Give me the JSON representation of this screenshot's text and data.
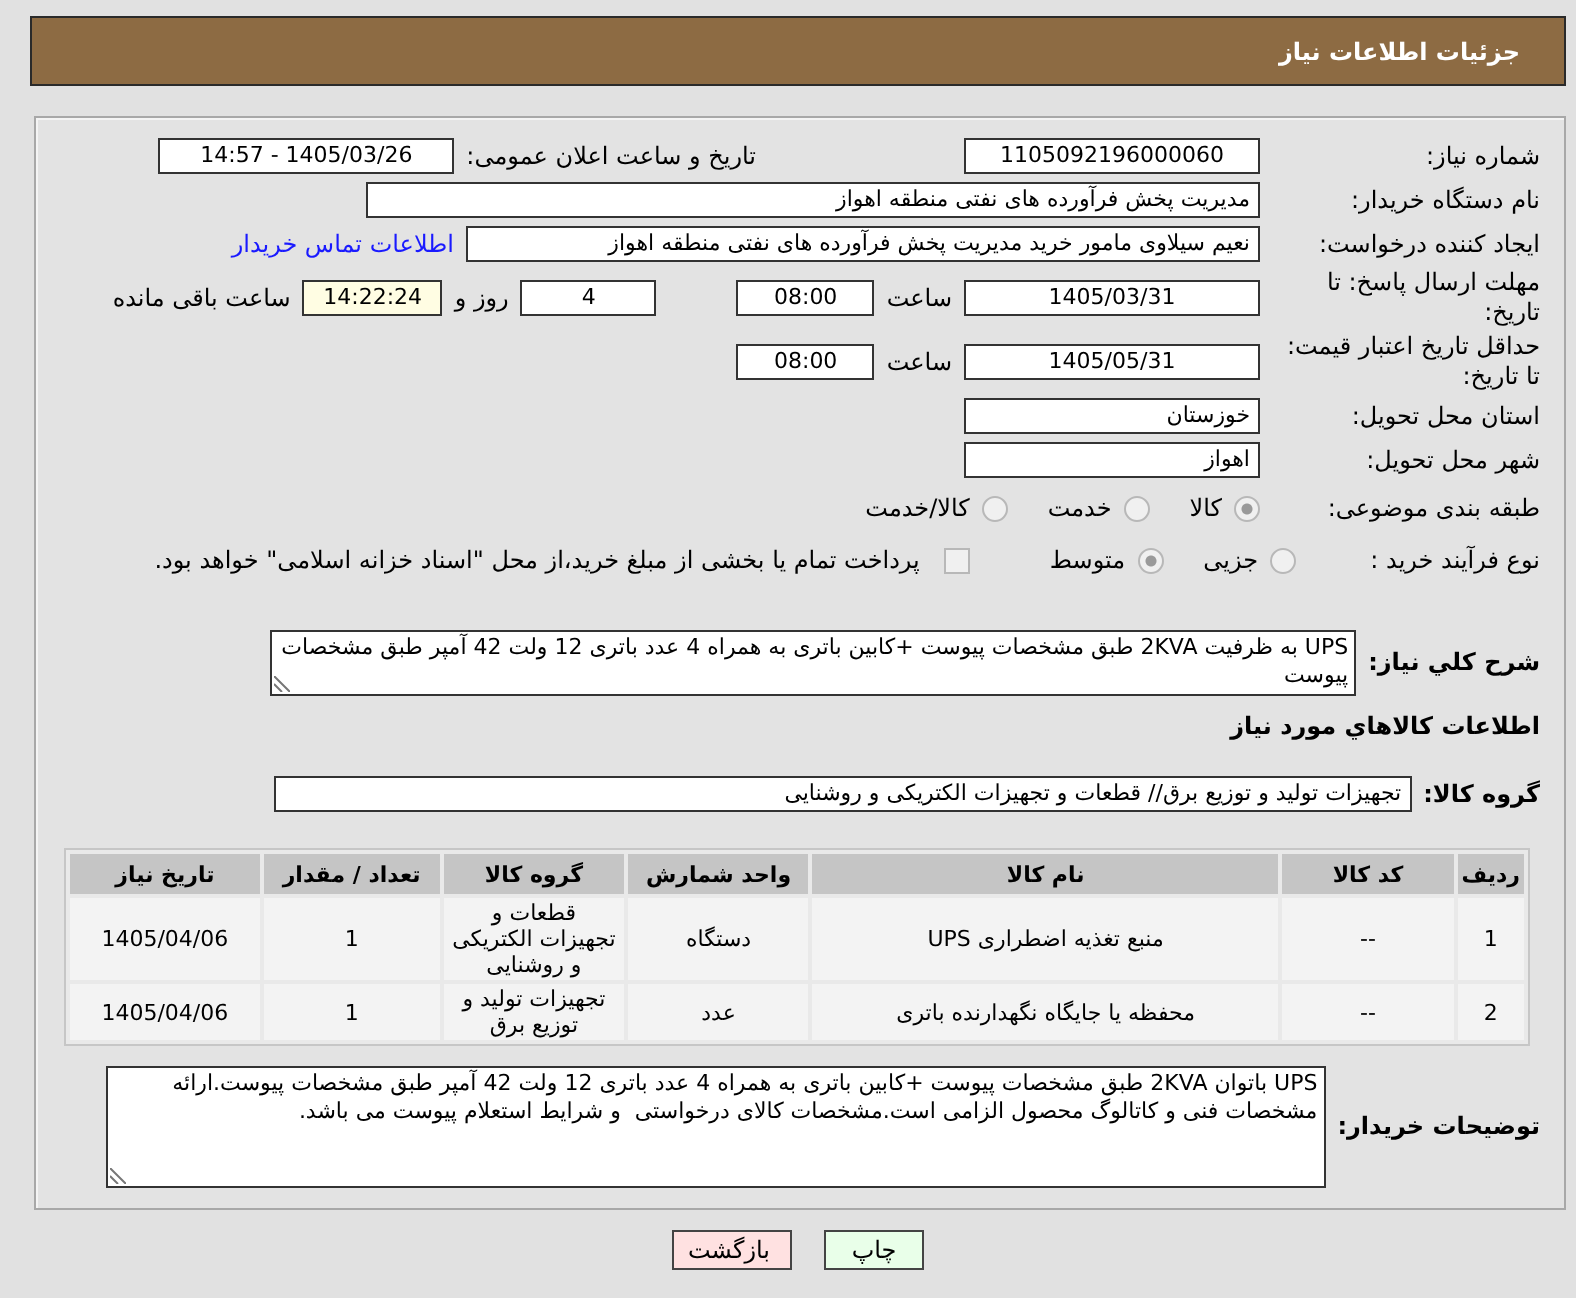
{
  "header": {
    "title": "جزئیات اطلاعات نیاز"
  },
  "need_info": {
    "need_number": {
      "label": "شماره نیاز:",
      "value": "1105092196000060"
    },
    "announce_datetime": {
      "label": "تاریخ و ساعت اعلان عمومی:",
      "value": "1405/03/26 - 14:57"
    },
    "buyer_org": {
      "label": "نام دستگاه خریدار:",
      "value": "مدیریت پخش فرآورده های نفتی منطقه اهواز"
    },
    "requester": {
      "label": "ایجاد کننده درخواست:",
      "value": "نعیم سیلاوی مامور خرید مدیریت پخش فرآورده های نفتی منطقه اهواز",
      "link": "اطلاعات تماس خریدار"
    },
    "response_deadline": {
      "label": "مهلت ارسال پاسخ: تا تاریخ:",
      "date": "1405/03/31",
      "time_label": "ساعت",
      "time": "08:00",
      "days": "4",
      "days_label": "روز و",
      "remaining": "14:22:24",
      "remaining_label": "ساعت باقی مانده"
    },
    "price_validity": {
      "label": "حداقل تاریخ اعتبار قیمت: تا تاریخ:",
      "date": "1405/05/31",
      "time_label": "ساعت",
      "time": "08:00"
    },
    "delivery_province": {
      "label": "استان محل تحویل:",
      "value": "خوزستان"
    },
    "delivery_city": {
      "label": "شهر محل تحویل:",
      "value": "اهواز"
    },
    "subject_category": {
      "label": "طبقه بندی موضوعی:",
      "options": [
        {
          "label": "کالا",
          "selected": true,
          "disabled": true
        },
        {
          "label": "خدمت",
          "selected": false,
          "disabled": true
        },
        {
          "label": "کالا/خدمت",
          "selected": false,
          "disabled": true
        }
      ]
    },
    "purchase_process": {
      "label": "نوع فرآیند خرید :",
      "options": [
        {
          "label": "جزیی",
          "selected": false,
          "disabled": true
        },
        {
          "label": "متوسط",
          "selected": true,
          "disabled": true
        }
      ],
      "treasury_payment": {
        "label": "پرداخت تمام یا بخشی از مبلغ خرید،از محل \"اسناد خزانه اسلامی\" خواهد بود.",
        "checked": false,
        "disabled": true
      }
    }
  },
  "description": {
    "label": "شرح کلي نیاز:",
    "value": "UPS به ظرفیت 2KVA طبق مشخصات پیوست +کابین باتری به همراه 4 عدد باتری 12 ولت 42 آمپر طبق مشخصات پیوست"
  },
  "items_section": {
    "title": "اطلاعات کالاهاي مورد نیاز",
    "group_label": "گروه کالا:",
    "group_value": "تجهیزات تولید و توزیع برق// قطعات و تجهیزات الکتریکی و روشنایی",
    "table": {
      "columns": [
        "ردیف",
        "کد کالا",
        "نام کالا",
        "واحد شمارش",
        "گروه کالا",
        "تعداد / مقدار",
        "تاریخ نیاز"
      ],
      "rows": [
        {
          "cells": [
            "1",
            "--",
            "منبع تغذیه اضطراری UPS",
            "دستگاه",
            "قطعات و تجهیزات الکتریکی و روشنایی",
            "1",
            "1405/04/06"
          ]
        },
        {
          "cells": [
            "2",
            "--",
            "محفظه یا جایگاه نگهدارنده باتری",
            "عدد",
            "تجهیزات تولید و توزیع برق",
            "1",
            "1405/04/06"
          ]
        }
      ]
    }
  },
  "buyer_notes": {
    "label": "توضیحات خریدار:",
    "value": "UPS باتوان 2KVA طبق مشخصات پیوست +کابین باتری به همراه 4 عدد باتری 12 ولت 42 آمپر طبق مشخصات پیوست.ارائه مشخصات فنی و کاتالوگ محصول الزامی است.مشخصات کالای درخواستی  و شرایط استعلام پیوست می باشد."
  },
  "buttons": [
    {
      "label": "چاپ",
      "kind": "print"
    },
    {
      "label": "بازگشت",
      "kind": "back"
    }
  ]
}
